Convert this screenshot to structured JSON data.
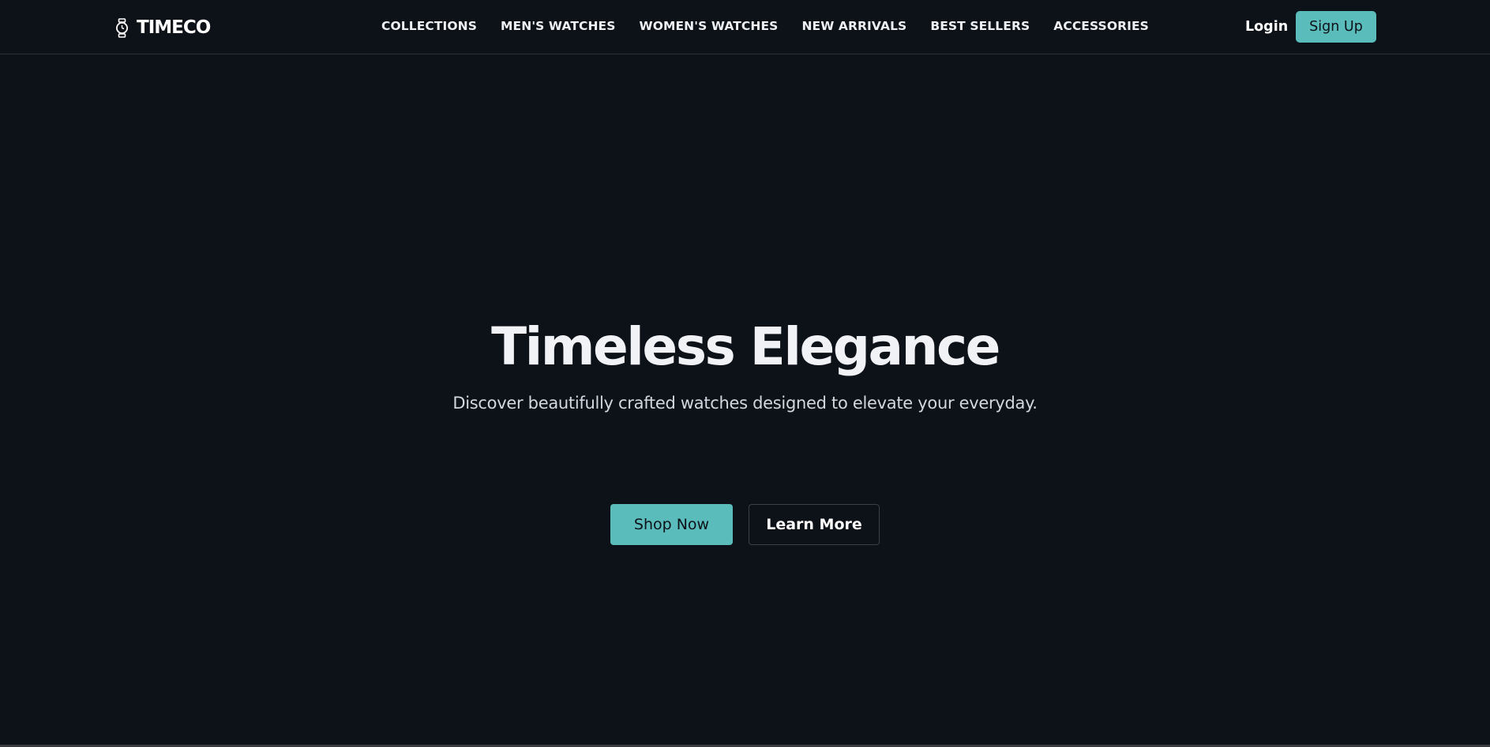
{
  "brand": {
    "name": "TIMECO",
    "icon": "watch-icon"
  },
  "nav": {
    "links": [
      "COLLECTIONS",
      "MEN'S WATCHES",
      "WOMEN'S WATCHES",
      "NEW ARRIVALS",
      "BEST SELLERS",
      "ACCESSORIES"
    ]
  },
  "auth": {
    "login_label": "Login",
    "signup_label": "Sign Up"
  },
  "hero": {
    "title": "Timeless Elegance",
    "subtitle": "Discover beautifully crafted watches designed to elevate your everyday.",
    "primary_cta": "Shop Now",
    "secondary_cta": "Learn More"
  },
  "colors": {
    "background": "#0d1118",
    "accent": "#5bbdbb",
    "text": "#f1f2f6"
  }
}
